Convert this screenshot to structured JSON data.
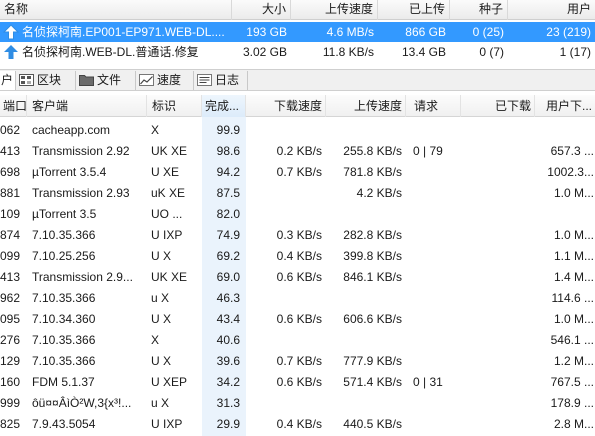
{
  "torrent_list": {
    "columns": [
      "名称",
      "大小",
      "上传速度",
      "已上传",
      "种子",
      "用户"
    ],
    "rows": [
      {
        "name": "名侦探柯南.EP001-EP971.WEB-DL....",
        "size": "193 GB",
        "upload_speed": "4.6 MB/s",
        "uploaded": "866 GB",
        "seeds": "0 (25)",
        "peers": "23 (219)",
        "selected": true
      },
      {
        "name": "名侦探柯南.WEB-DL.普通话.修复",
        "size": "3.02 GB",
        "upload_speed": "11.8 KB/s",
        "uploaded": "13.4 GB",
        "seeds": "0 (7)",
        "peers": "1 (17)",
        "selected": false
      }
    ]
  },
  "tabs": [
    {
      "label": "户",
      "icon": "users-icon",
      "active": true
    },
    {
      "label": "区块",
      "icon": "pieces-icon",
      "active": false
    },
    {
      "label": "文件",
      "icon": "folder-icon",
      "active": false
    },
    {
      "label": "速度",
      "icon": "speed-graph-icon",
      "active": false
    },
    {
      "label": "日志",
      "icon": "log-icon",
      "active": false
    }
  ],
  "peer_list": {
    "columns": [
      "端口",
      "客户端",
      "标识",
      "完成...",
      "下载速度",
      "上传速度",
      "请求",
      "已下载",
      "用户下..."
    ],
    "rows": [
      {
        "port": "062",
        "client": "cacheapp.com",
        "flags": "X",
        "done": "99.9",
        "down": "",
        "up": "",
        "reqs": "",
        "downloaded": "",
        "peer_dl": ""
      },
      {
        "port": "413",
        "client": "Transmission 2.92",
        "flags": "UK XE",
        "done": "98.6",
        "down": "0.2 KB/s",
        "up": "255.8 KB/s",
        "reqs": "0 | 79",
        "downloaded": "",
        "peer_dl": "657.3 ..."
      },
      {
        "port": "698",
        "client": "µTorrent 3.5.4",
        "flags": "U XE",
        "done": "94.2",
        "down": "0.7 KB/s",
        "up": "781.8 KB/s",
        "reqs": "",
        "downloaded": "",
        "peer_dl": "1002.3..."
      },
      {
        "port": "881",
        "client": "Transmission 2.93",
        "flags": "uK XE",
        "done": "87.5",
        "down": "",
        "up": "4.2 KB/s",
        "reqs": "",
        "downloaded": "",
        "peer_dl": "1.0 M..."
      },
      {
        "port": "109",
        "client": "µTorrent 3.5",
        "flags": "UO ...",
        "done": "82.0",
        "down": "",
        "up": "",
        "reqs": "",
        "downloaded": "",
        "peer_dl": ""
      },
      {
        "port": "874",
        "client": "7.10.35.366",
        "flags": "U IXP",
        "done": "74.9",
        "down": "0.3 KB/s",
        "up": "282.8 KB/s",
        "reqs": "",
        "downloaded": "",
        "peer_dl": "1.0 M..."
      },
      {
        "port": "099",
        "client": "7.10.25.256",
        "flags": "U X",
        "done": "69.2",
        "down": "0.4 KB/s",
        "up": "399.8 KB/s",
        "reqs": "",
        "downloaded": "",
        "peer_dl": "1.1 M..."
      },
      {
        "port": "413",
        "client": "Transmission 2.9...",
        "flags": "UK XE",
        "done": "69.0",
        "down": "0.6 KB/s",
        "up": "846.1 KB/s",
        "reqs": "",
        "downloaded": "",
        "peer_dl": "1.4 M..."
      },
      {
        "port": "962",
        "client": "7.10.35.366",
        "flags": "u X",
        "done": "46.3",
        "down": "",
        "up": "",
        "reqs": "",
        "downloaded": "",
        "peer_dl": "114.6 ..."
      },
      {
        "port": "095",
        "client": "7.10.34.360",
        "flags": "U X",
        "done": "43.4",
        "down": "0.6 KB/s",
        "up": "606.6 KB/s",
        "reqs": "",
        "downloaded": "",
        "peer_dl": "1.0 M..."
      },
      {
        "port": "276",
        "client": "7.10.35.366",
        "flags": "X",
        "done": "40.6",
        "down": "",
        "up": "",
        "reqs": "",
        "downloaded": "",
        "peer_dl": "546.1 ..."
      },
      {
        "port": "129",
        "client": "7.10.35.366",
        "flags": "U X",
        "done": "39.6",
        "down": "0.7 KB/s",
        "up": "777.9 KB/s",
        "reqs": "",
        "downloaded": "",
        "peer_dl": "1.2 M..."
      },
      {
        "port": "160",
        "client": "FDM 5.1.37",
        "flags": "U XEP",
        "done": "34.2",
        "down": "0.6 KB/s",
        "up": "571.4 KB/s",
        "reqs": "0 | 31",
        "downloaded": "",
        "peer_dl": "767.5 ..."
      },
      {
        "port": "999",
        "client": "ôü¤¤ÂìÒ²W,3{x³!...",
        "flags": "u X",
        "done": "31.3",
        "down": "",
        "up": "",
        "reqs": "",
        "downloaded": "",
        "peer_dl": "178.9 ..."
      },
      {
        "port": "825",
        "client": "7.9.43.5054",
        "flags": "U IXP",
        "done": "29.9",
        "down": "0.4 KB/s",
        "up": "440.5 KB/s",
        "reqs": "",
        "downloaded": "",
        "peer_dl": "2.8 M..."
      }
    ]
  },
  "colors": {
    "selection": "#3399ff",
    "arrow": "#2f8de4",
    "sorted_column": "#eaf3fc"
  }
}
